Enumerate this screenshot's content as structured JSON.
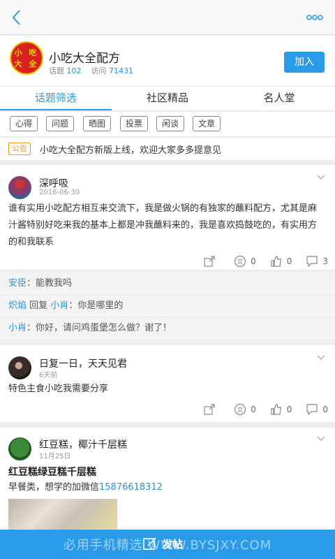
{
  "colors": {
    "accent": "#2a9be8",
    "logo_red": "#d8211c",
    "notice_orange": "#f29a1e"
  },
  "topbar": {
    "back_icon": "chevron-left-icon",
    "more_icon": "more-dots-icon"
  },
  "group": {
    "logo_text_line1": "小 吃",
    "logo_text_line2": "大 全",
    "name": "小吃大全配方",
    "topics_label": "话题",
    "topics_count": "102",
    "visits_label": "访问",
    "visits_count": "71431",
    "join_label": "加入"
  },
  "tabs": [
    {
      "label": "话题筛选",
      "active": true
    },
    {
      "label": "社区精品",
      "active": false
    },
    {
      "label": "名人堂",
      "active": false
    }
  ],
  "filters": [
    "心得",
    "问题",
    "晒图",
    "投票",
    "闲谈",
    "文章"
  ],
  "notice": {
    "tag": "公告",
    "text": "小吃大全配方新版上线，欢迎大家多多提意见"
  },
  "posts": [
    {
      "author": "深呼吸",
      "date": "2016-06-30",
      "body": "谁有实用小吃配方相互来交流下，我是做火锅的有独家的蘸料配方，尤其是麻汁酱特别好吃来我的基本上都是冲我蘸料来的，我是喜欢捣鼓吃的，有实用方的和我联系",
      "reward": "0",
      "likes": "0",
      "comments_count": "3",
      "comments": [
        {
          "user": "安臣",
          "sep": "：",
          "text": "能教我吗"
        },
        {
          "user": "炽焰",
          "mid": " 回复 ",
          "reply_to": "小肖",
          "sep": "：",
          "text": "你是哪里的"
        },
        {
          "user": "小肖",
          "sep": "：",
          "text": "你好，请问鸡蛋堡怎么做？谢了！"
        }
      ]
    },
    {
      "author": "日复一日，天天见君",
      "date": "6天前",
      "body": "特色主食小吃我需要分享",
      "reward": "0",
      "likes": "0",
      "comments_count": "0"
    },
    {
      "author": "红豆糕，椰汁千层糕",
      "date": "11月25日",
      "title": "红豆糕绿豆糕千层糕",
      "body_prefix": "早餐类，想学的加微信",
      "phone": "15876618312"
    }
  ],
  "bottom": {
    "post_label": "发帖",
    "watermark": "必用手机精选 WWW.BYSJXY.COM"
  }
}
